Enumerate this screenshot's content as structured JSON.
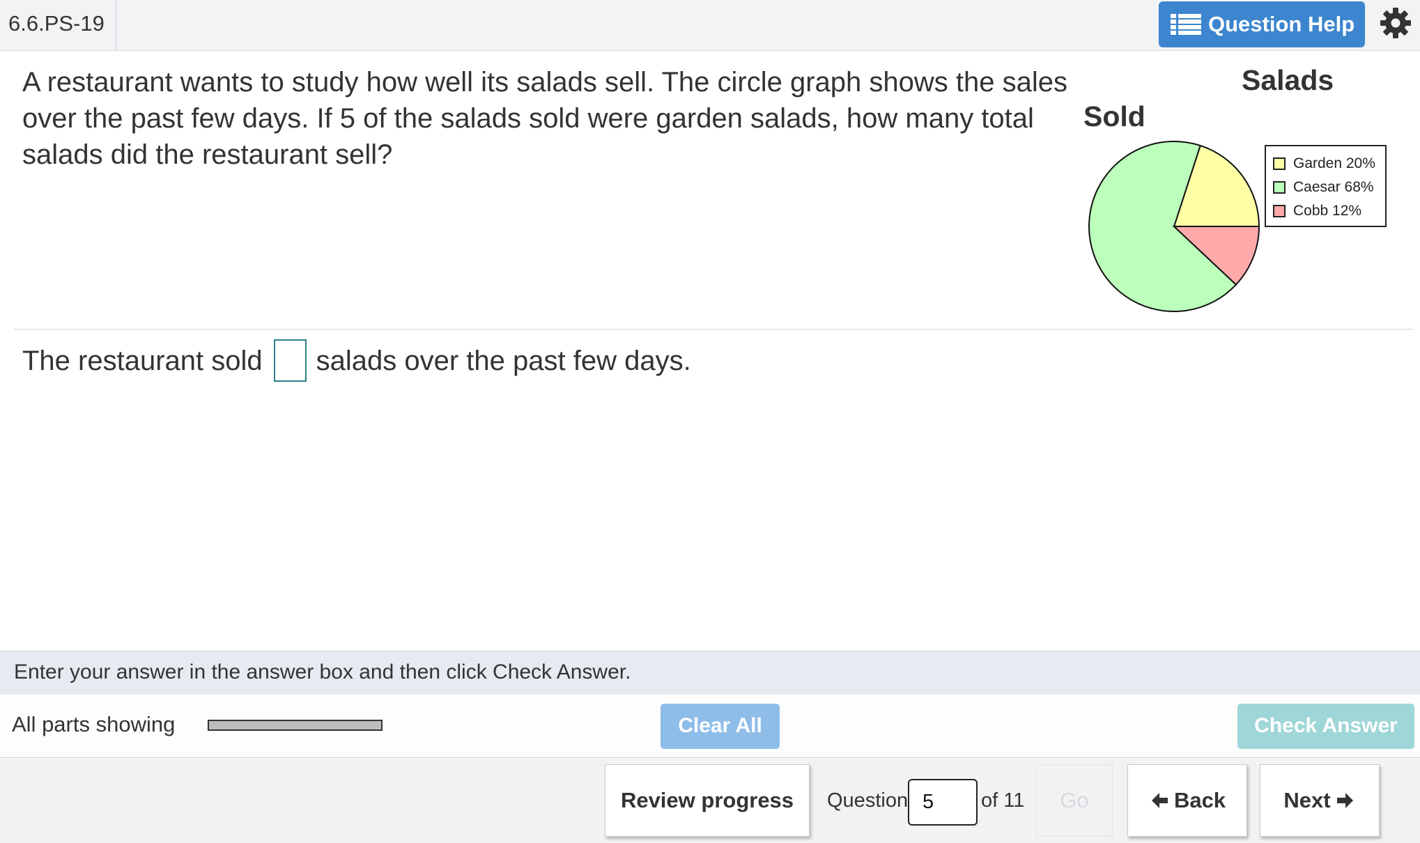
{
  "header": {
    "question_id": "6.6.PS-19",
    "help_label": "Question Help",
    "help_icon": "list-icon",
    "settings_icon": "gear-icon"
  },
  "question": {
    "text": "A restaurant wants to study how well its salads sell. The circle graph shows the sales over the past few days. If 5 of the salads sold were garden salads, how many total salads did the restaurant sell?"
  },
  "chart_data": {
    "type": "pie",
    "title_line1": "Salads",
    "title_line2": "Sold",
    "slices": [
      {
        "label": "Garden 20%",
        "value": 20,
        "color": "#ffffa6"
      },
      {
        "label": "Caesar 68%",
        "value": 68,
        "color": "#bbffbb"
      },
      {
        "label": "Cobb 12%",
        "value": 12,
        "color": "#ffaaaa"
      }
    ],
    "legend_position": "right"
  },
  "answer": {
    "prefix": "The restaurant sold",
    "suffix": "salads over the past few days.",
    "value": ""
  },
  "instructions": "Enter your answer in the answer box and then click Check Answer.",
  "parts": {
    "label": "All parts showing",
    "clear_label": "Clear All",
    "check_label": "Check Answer"
  },
  "footer": {
    "review_label": "Review progress",
    "question_label": "Question",
    "question_number": "5",
    "of_label": "of 11",
    "go_label": "Go",
    "back_label": "Back",
    "next_label": "Next"
  }
}
